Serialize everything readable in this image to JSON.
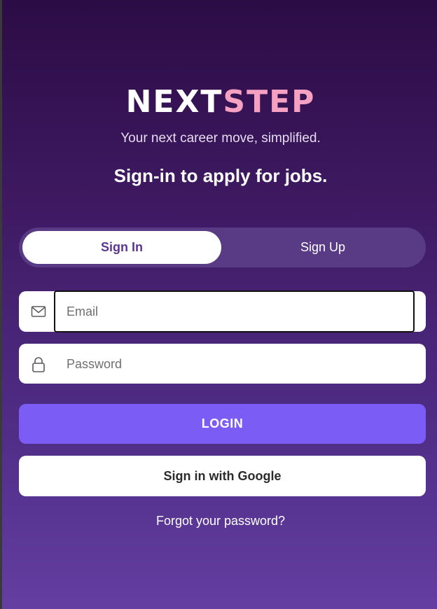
{
  "brand": {
    "name_part1": "NEXT",
    "name_part2": "STEP",
    "color_part1": "#ffffff",
    "color_part2": "#f6a1c1"
  },
  "tagline": "Your next career move, simplified.",
  "headline": "Sign-in to apply for jobs.",
  "tabs": [
    {
      "label": "Sign In",
      "active": true
    },
    {
      "label": "Sign Up",
      "active": false
    }
  ],
  "form": {
    "email": {
      "placeholder": "Email",
      "value": "",
      "icon": "mail-icon",
      "focused": true
    },
    "password": {
      "placeholder": "Password",
      "value": "",
      "icon": "lock-icon"
    }
  },
  "buttons": {
    "login_label": "LOGIN",
    "google_label": "Sign in with Google"
  },
  "links": {
    "forgot_password": "Forgot your password?"
  },
  "colors": {
    "background_top": "#2c0c45",
    "background_bottom": "#643ea1",
    "accent": "#7b5cf5",
    "tab_active_text": "#5d3692"
  }
}
